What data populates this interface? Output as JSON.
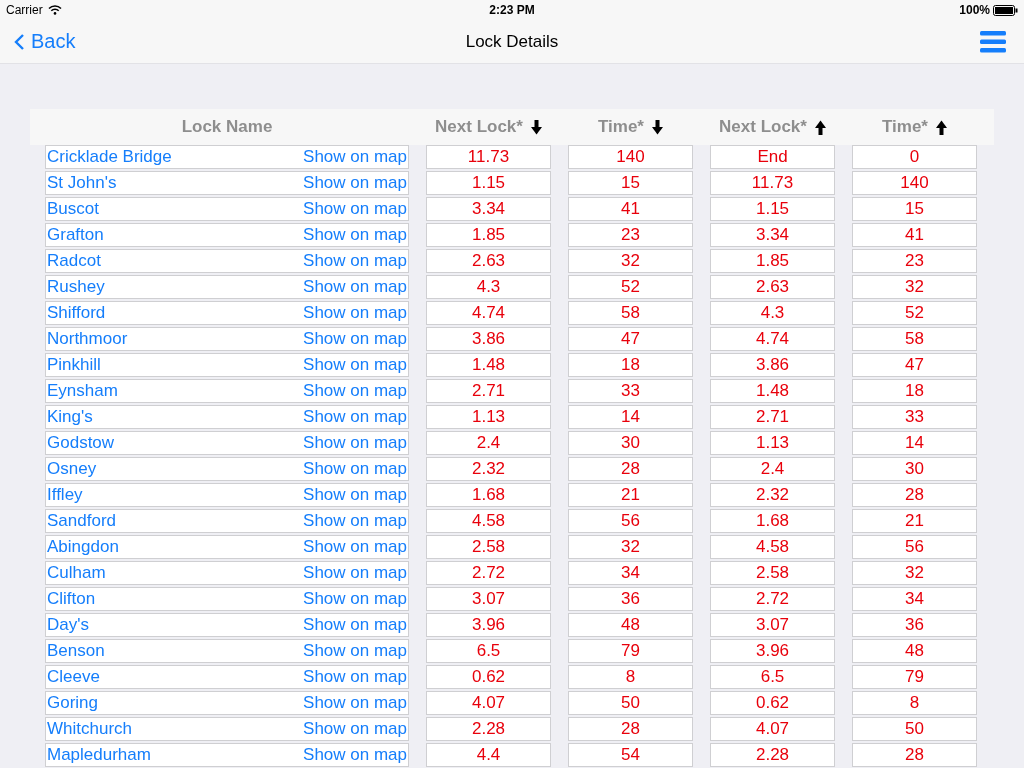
{
  "status_bar": {
    "carrier": "Carrier",
    "time": "2:23 PM",
    "battery": "100%"
  },
  "nav": {
    "back": "Back",
    "title": "Lock Details"
  },
  "table": {
    "columns": [
      {
        "label": "Lock Name"
      },
      {
        "label": "Next Lock*",
        "kind": "down"
      },
      {
        "label": "Time*",
        "kind": "down"
      },
      {
        "label": "Next Lock*",
        "kind": "up"
      },
      {
        "label": "Time*",
        "kind": "up"
      }
    ],
    "rows": [
      {
        "name": "Cricklade Bridge",
        "map": "Show on map",
        "values": [
          "11.73",
          "140",
          "End",
          "0"
        ]
      },
      {
        "name": "St John's",
        "map": "Show on map",
        "values": [
          "1.15",
          "15",
          "11.73",
          "140"
        ]
      },
      {
        "name": "Buscot",
        "map": "Show on map",
        "values": [
          "3.34",
          "41",
          "1.15",
          "15"
        ]
      },
      {
        "name": "Grafton",
        "map": "Show on map",
        "values": [
          "1.85",
          "23",
          "3.34",
          "41"
        ]
      },
      {
        "name": "Radcot",
        "map": "Show on map",
        "values": [
          "2.63",
          "32",
          "1.85",
          "23"
        ]
      },
      {
        "name": "Rushey",
        "map": "Show on map",
        "values": [
          "4.3",
          "52",
          "2.63",
          "32"
        ]
      },
      {
        "name": "Shifford",
        "map": "Show on map",
        "values": [
          "4.74",
          "58",
          "4.3",
          "52"
        ]
      },
      {
        "name": "Northmoor",
        "map": "Show on map",
        "values": [
          "3.86",
          "47",
          "4.74",
          "58"
        ]
      },
      {
        "name": "Pinkhill",
        "map": "Show on map",
        "values": [
          "1.48",
          "18",
          "3.86",
          "47"
        ]
      },
      {
        "name": "Eynsham",
        "map": "Show on map",
        "values": [
          "2.71",
          "33",
          "1.48",
          "18"
        ]
      },
      {
        "name": "King's",
        "map": "Show on map",
        "values": [
          "1.13",
          "14",
          "2.71",
          "33"
        ]
      },
      {
        "name": "Godstow",
        "map": "Show on map",
        "values": [
          "2.4",
          "30",
          "1.13",
          "14"
        ]
      },
      {
        "name": "Osney",
        "map": "Show on map",
        "values": [
          "2.32",
          "28",
          "2.4",
          "30"
        ]
      },
      {
        "name": "Iffley",
        "map": "Show on map",
        "values": [
          "1.68",
          "21",
          "2.32",
          "28"
        ]
      },
      {
        "name": "Sandford",
        "map": "Show on map",
        "values": [
          "4.58",
          "56",
          "1.68",
          "21"
        ]
      },
      {
        "name": "Abingdon",
        "map": "Show on map",
        "values": [
          "2.58",
          "32",
          "4.58",
          "56"
        ]
      },
      {
        "name": "Culham",
        "map": "Show on map",
        "values": [
          "2.72",
          "34",
          "2.58",
          "32"
        ]
      },
      {
        "name": "Clifton",
        "map": "Show on map",
        "values": [
          "3.07",
          "36",
          "2.72",
          "34"
        ]
      },
      {
        "name": "Day's",
        "map": "Show on map",
        "values": [
          "3.96",
          "48",
          "3.07",
          "36"
        ]
      },
      {
        "name": "Benson",
        "map": "Show on map",
        "values": [
          "6.5",
          "79",
          "3.96",
          "48"
        ]
      },
      {
        "name": "Cleeve",
        "map": "Show on map",
        "values": [
          "0.62",
          "8",
          "6.5",
          "79"
        ]
      },
      {
        "name": "Goring",
        "map": "Show on map",
        "values": [
          "4.07",
          "50",
          "0.62",
          "8"
        ]
      },
      {
        "name": "Whitchurch",
        "map": "Show on map",
        "values": [
          "2.28",
          "28",
          "4.07",
          "50"
        ]
      },
      {
        "name": "Mapledurham",
        "map": "Show on map",
        "values": [
          "4.4",
          "54",
          "2.28",
          "28"
        ]
      }
    ]
  }
}
